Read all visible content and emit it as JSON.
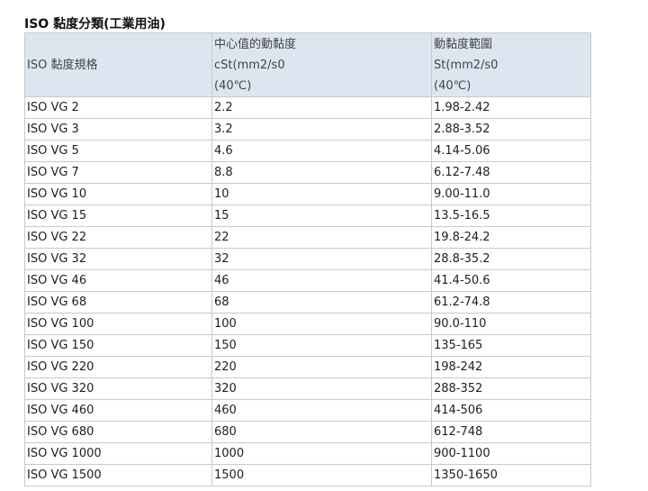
{
  "title": "ISO 黏度分類(工業用油)",
  "table": {
    "headers": {
      "col1": "ISO 黏度規格",
      "col2": [
        "中心值的動黏度",
        "cSt(mm2/s0",
        "(40℃)"
      ],
      "col3": [
        "動黏度範圍",
        "St(mm2/s0",
        "(40℃)"
      ]
    },
    "rows": [
      [
        "ISO VG 2",
        "2.2",
        "1.98-2.42"
      ],
      [
        "ISO VG 3",
        "3.2",
        "2.88-3.52"
      ],
      [
        "ISO VG 5",
        "4.6",
        "4.14-5.06"
      ],
      [
        "ISO VG 7",
        "8.8",
        "6.12-7.48"
      ],
      [
        "ISO VG 10",
        "10",
        "9.00-11.0"
      ],
      [
        "ISO VG 15",
        "15",
        "13.5-16.5"
      ],
      [
        "ISO VG 22",
        "22",
        "19.8-24.2"
      ],
      [
        "ISO VG 32",
        "32",
        "28.8-35.2"
      ],
      [
        "ISO VG 46",
        "46",
        "41.4-50.6"
      ],
      [
        "ISO VG 68",
        "68",
        "61.2-74.8"
      ],
      [
        "ISO VG 100",
        "100",
        "90.0-110"
      ],
      [
        "ISO VG 150",
        "150",
        "135-165"
      ],
      [
        "ISO VG 220",
        "220",
        "198-242"
      ],
      [
        "ISO VG 320",
        "320",
        "288-352"
      ],
      [
        "ISO VG 460",
        "460",
        "414-506"
      ],
      [
        "ISO VG 680",
        "680",
        "612-748"
      ],
      [
        "ISO VG 1000",
        "1000",
        "900-1100"
      ],
      [
        "ISO VG 1500",
        "1500",
        "1350-1650"
      ]
    ]
  }
}
